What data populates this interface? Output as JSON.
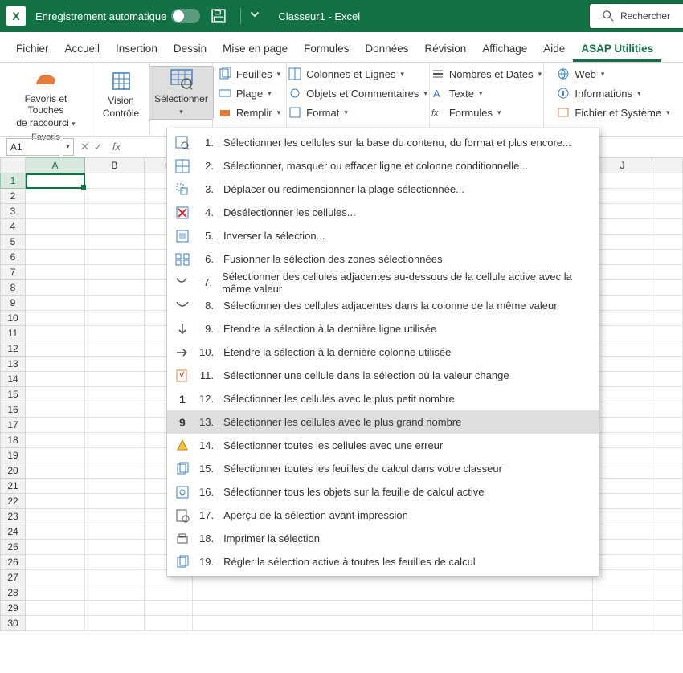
{
  "titlebar": {
    "autosave_label": "Enregistrement automatique",
    "doc_title": "Classeur1  -  Excel",
    "search_label": "Rechercher"
  },
  "tabs": [
    "Fichier",
    "Accueil",
    "Insertion",
    "Dessin",
    "Mise en page",
    "Formules",
    "Données",
    "Révision",
    "Affichage",
    "Aide",
    "ASAP Utilities"
  ],
  "tabs_active_index": 10,
  "ribbon": {
    "favoris_line1": "Favoris et Touches",
    "favoris_line2": "de raccourci",
    "favoris_caption": "Favoris",
    "vision_line1": "Vision",
    "vision_line2": "Contrôle",
    "select_label": "Sélectionner",
    "col1": [
      "Feuilles",
      "Plage",
      "Remplir"
    ],
    "col2": [
      "Colonnes et Lignes",
      "Objets et Commentaires",
      "Format"
    ],
    "col3": [
      "Nombres et Dates",
      "Texte",
      "Formules"
    ],
    "col4": [
      "Web",
      "Informations",
      "Fichier et Système"
    ]
  },
  "name_box": "A1",
  "columns": [
    "A",
    "B",
    "C",
    "J"
  ],
  "row_count": 30,
  "menu": [
    {
      "n": "1.",
      "t": "Sélectionner les cellules sur la base du contenu, du format et plus encore..."
    },
    {
      "n": "2.",
      "t": "Sélectionner, masquer ou effacer ligne et colonne conditionnelle..."
    },
    {
      "n": "3.",
      "t": "Déplacer ou redimensionner la plage sélectionnée..."
    },
    {
      "n": "4.",
      "t": "Désélectionner les cellules..."
    },
    {
      "n": "5.",
      "t": "Inverser la sélection..."
    },
    {
      "n": "6.",
      "t": "Fusionner la sélection des zones sélectionnées"
    },
    {
      "n": "7.",
      "t": "Sélectionner des cellules adjacentes au-dessous de la cellule active avec la même valeur"
    },
    {
      "n": "8.",
      "t": "Sélectionner des cellules adjacentes dans la colonne de la même valeur"
    },
    {
      "n": "9.",
      "t": "Étendre la sélection à la dernière ligne utilisée"
    },
    {
      "n": "10.",
      "t": "Étendre la sélection à la dernière colonne utilisée"
    },
    {
      "n": "11.",
      "t": "Sélectionner une cellule dans la sélection où la valeur change"
    },
    {
      "n": "12.",
      "t": "Sélectionner les cellules avec le plus petit nombre"
    },
    {
      "n": "13.",
      "t": "Sélectionner les cellules avec le plus grand nombre"
    },
    {
      "n": "14.",
      "t": "Sélectionner toutes les cellules avec une erreur"
    },
    {
      "n": "15.",
      "t": "Sélectionner toutes les feuilles de calcul dans votre classeur"
    },
    {
      "n": "16.",
      "t": "Sélectionner tous les objets sur la feuille de calcul active"
    },
    {
      "n": "17.",
      "t": "Aperçu de la sélection avant impression"
    },
    {
      "n": "18.",
      "t": "Imprimer la sélection"
    },
    {
      "n": "19.",
      "t": "Régler la sélection active à toutes les feuilles de calcul"
    }
  ],
  "menu_hover_index": 12
}
